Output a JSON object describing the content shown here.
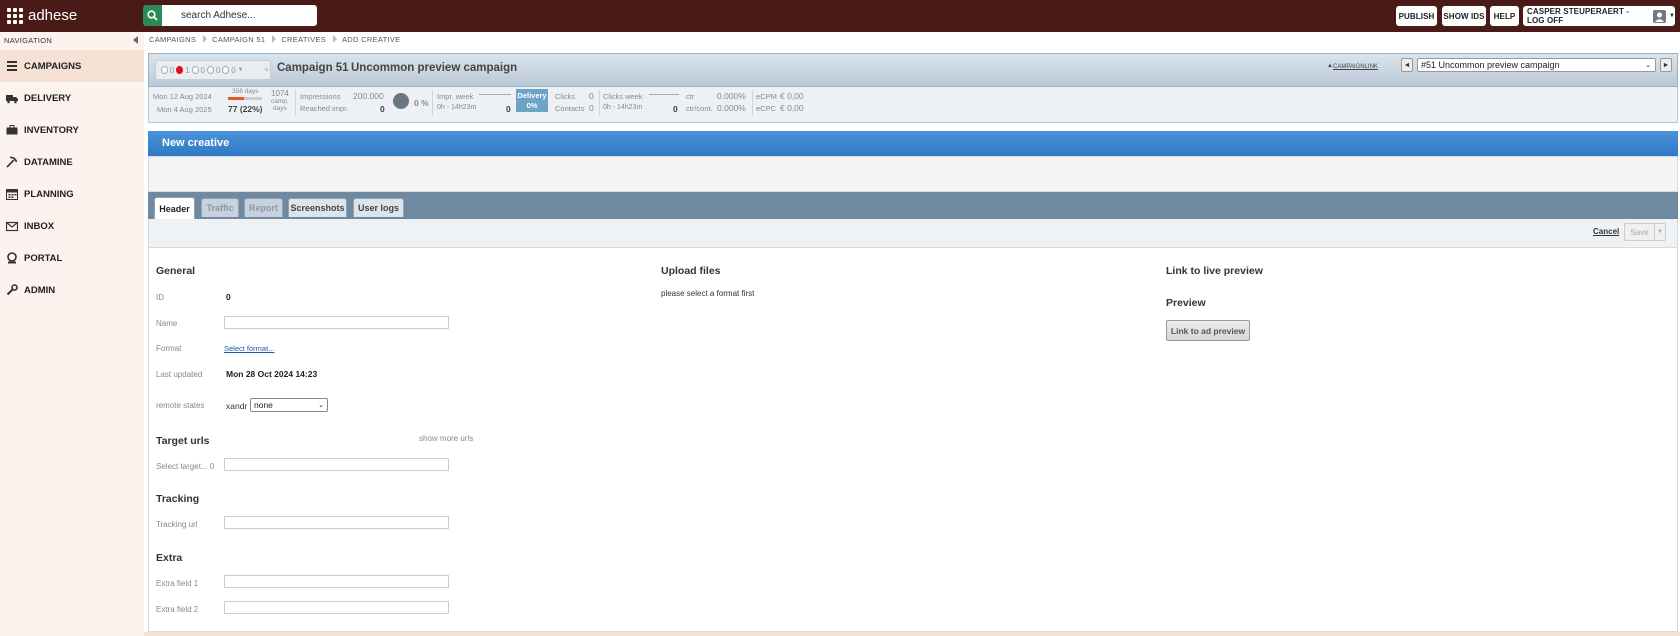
{
  "app": {
    "name": "adhese"
  },
  "search": {
    "placeholder": "search Adhese..."
  },
  "topbar": {
    "publish": "PUBLISH",
    "show_ids": "SHOW IDS",
    "help": "HELP",
    "user": "CASPER STEUPERAERT - LOG OFF"
  },
  "sidebar": {
    "heading": "NAVIGATION",
    "items": [
      {
        "label": "CAMPAIGNS",
        "icon": "campaigns-icon",
        "active": true
      },
      {
        "label": "DELIVERY",
        "icon": "truck-icon"
      },
      {
        "label": "INVENTORY",
        "icon": "briefcase-icon"
      },
      {
        "label": "DATAMINE",
        "icon": "pickaxe-icon"
      },
      {
        "label": "PLANNING",
        "icon": "calendar-icon"
      },
      {
        "label": "INBOX",
        "icon": "envelope-icon"
      },
      {
        "label": "PORTAL",
        "icon": "portal-icon"
      },
      {
        "label": "ADMIN",
        "icon": "wrench-icon"
      }
    ]
  },
  "breadcrumb": [
    "CAMPAIGNS",
    "CAMPAIGN 51",
    "CREATIVES",
    "ADD CREATIVE"
  ],
  "campaign": {
    "state_counts": [
      "0",
      "1",
      "0",
      "0",
      "0"
    ],
    "title": "Campaign 51",
    "name": "Uncommon preview campaign",
    "link_text": "CAMPAIGNLINK",
    "selector_value": "#51 Uncommon preview campaign",
    "prev": "◄",
    "next": "►"
  },
  "stats": {
    "start_date": "Mon 12 Aug 2024",
    "end_date": "Mon 4 Aug 2025",
    "days_total": "358 days",
    "days_elapsed": "77 (22%)",
    "days_progress": 0.22,
    "camp_days_num": "1074",
    "camp_days_label1": "camp.",
    "camp_days_label2": "days",
    "impressions_label": "Impressions",
    "impressions_value": "200.000",
    "reached_label": "Reached impr.",
    "reached_value": "0",
    "percent": "0 %",
    "impr_week_label": "Impr. week",
    "impr_week_range": "0h - 14h23m",
    "impr_week_value": "0",
    "delivery_label": "Delivery",
    "delivery_value": "0%",
    "clicks_label": "Clicks",
    "clicks_value": "0",
    "contacts_label": "Contacts",
    "contacts_value": "0",
    "clicks_week_label": "Clicks week",
    "clicks_week_range": "0h - 14h23m",
    "clicks_week_value": "0",
    "ctr_label": "ctr",
    "ctr_value": "0.000%",
    "ctrcont_label": "ctr/cont.",
    "ctrcont_value": "0.000%",
    "ecpm_label": "eCPM",
    "ecpm_value": "€ 0,00",
    "ecpc_label": "eCPC",
    "ecpc_value": "€ 0,00"
  },
  "panel": {
    "title": "New creative"
  },
  "tabs": [
    "Header",
    "Traffic",
    "Report",
    "Screenshots",
    "User logs"
  ],
  "actions": {
    "cancel": "Cancel",
    "save": "Save"
  },
  "general": {
    "title": "General",
    "id_label": "ID",
    "id_value": "0",
    "name_label": "Name",
    "name_value": "",
    "format_label": "Format",
    "format_link": "Select format...",
    "updated_label": "Last updated",
    "updated_value": "Mon 28 Oct 2024 14:23",
    "remote_label": "remote states",
    "remote_key": "xandr",
    "remote_value": "none"
  },
  "target_urls": {
    "title": "Target urls",
    "show_more": "show more urls",
    "select_label": "Select target... 0"
  },
  "tracking": {
    "title": "Tracking",
    "url_label": "Tracking url"
  },
  "extra": {
    "title": "Extra",
    "field1_label": "Extra field 1",
    "field2_label": "Extra field 2"
  },
  "upload": {
    "title": "Upload files",
    "message": "please select a format first"
  },
  "preview": {
    "live_title": "Link to live preview",
    "title": "Preview",
    "button": "Link to ad preview"
  },
  "colors": {
    "topbar": "#4a1a16",
    "accent_green": "#2d8a57",
    "panel_blue": "#3a86d0",
    "sidebar_bg": "#fcf3ee"
  }
}
